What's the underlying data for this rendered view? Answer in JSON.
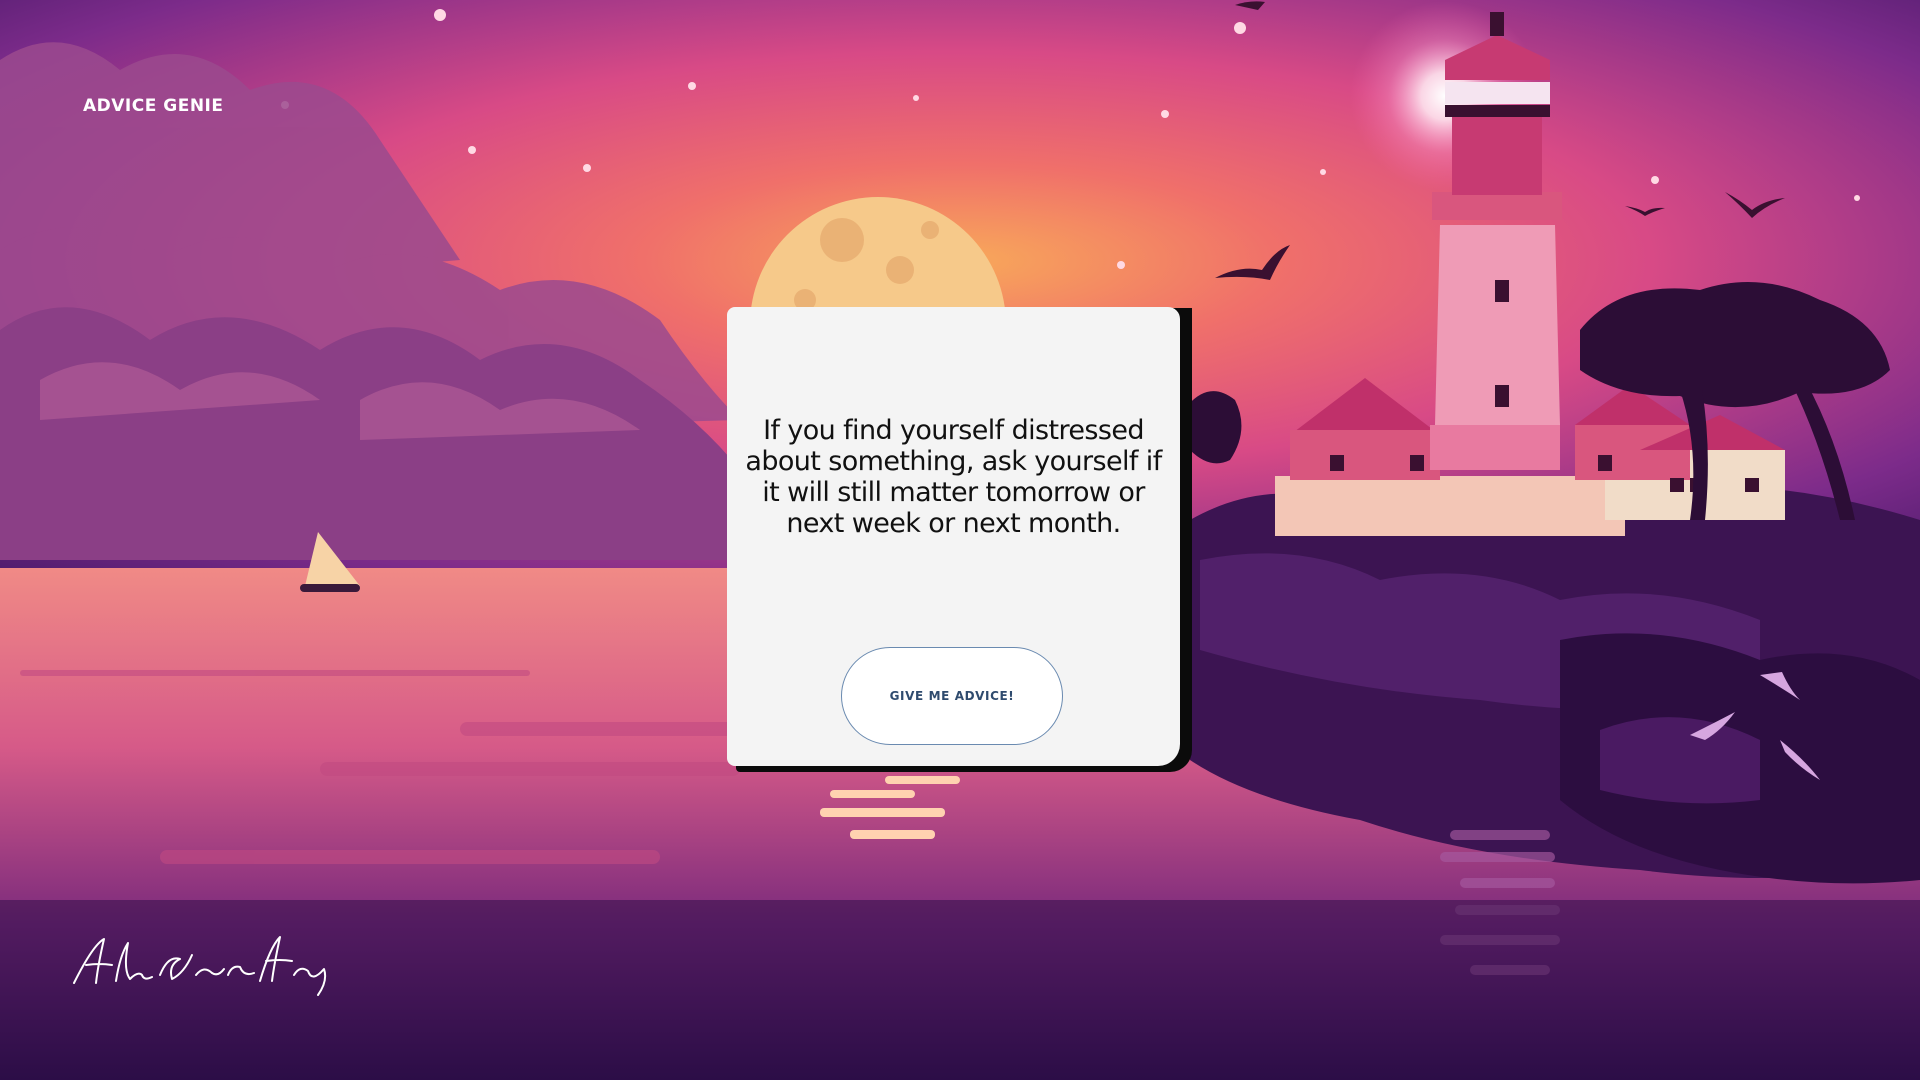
{
  "app": {
    "brand": "ADVICE GENIE"
  },
  "advice": {
    "text": "If you find yourself distressed about something, ask yourself if it will still matter tomorrow or next week or next month.",
    "button_label": "GIVE ME ADVICE!"
  },
  "signature": {
    "text": "AlenScariaAntony"
  },
  "colors": {
    "sky_top": "#5b1f74",
    "sky_mid": "#e0457f",
    "horizon_glow": "#f6a15e",
    "sea": "#e27a85",
    "deep_water": "#3a1352",
    "card_background": "#f4f4f4",
    "button_text": "#2f4b6e"
  }
}
